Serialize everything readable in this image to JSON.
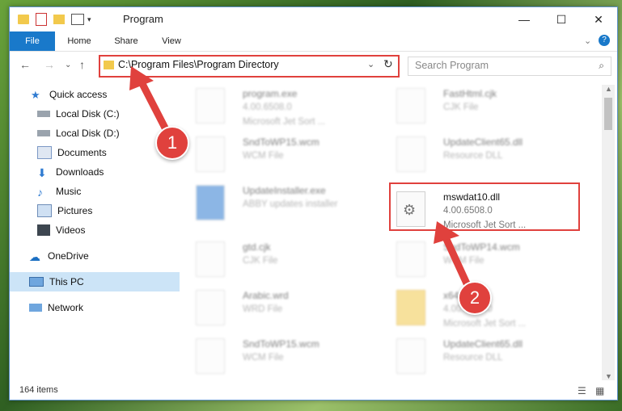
{
  "window": {
    "title": "Program"
  },
  "ribbon": {
    "tabs": [
      "File",
      "Home",
      "Share",
      "View"
    ]
  },
  "nav": {
    "address": "C:\\Program Files\\Program Directory",
    "search_placeholder": "Search Program"
  },
  "sidebar": {
    "items": [
      {
        "label": "Quick access",
        "icon": "star-icon",
        "pinned": false
      },
      {
        "label": "Local Disk (C:)",
        "icon": "drive-icon",
        "pinned": true
      },
      {
        "label": "Local Disk (D:)",
        "icon": "drive-icon",
        "pinned": true
      },
      {
        "label": "Documents",
        "icon": "documents-icon",
        "pinned": true
      },
      {
        "label": "Downloads",
        "icon": "download-icon",
        "pinned": true
      },
      {
        "label": "Music",
        "icon": "music-icon",
        "pinned": true
      },
      {
        "label": "Pictures",
        "icon": "pictures-icon",
        "pinned": true
      },
      {
        "label": "Videos",
        "icon": "videos-icon",
        "pinned": true
      },
      {
        "label": "OneDrive",
        "icon": "cloud-icon",
        "pinned": false
      },
      {
        "label": "This PC",
        "icon": "pc-icon",
        "pinned": false,
        "selected": true
      },
      {
        "label": "Network",
        "icon": "network-icon",
        "pinned": false
      }
    ]
  },
  "files": [
    {
      "name": "program.exe",
      "line2": "4.00.6508.0",
      "line3": "Microsoft Jet Sort ...",
      "col": 0,
      "row": 0
    },
    {
      "name": "FastHtml.cjk",
      "line2": "CJK File",
      "line3": "",
      "col": 1,
      "row": 0
    },
    {
      "name": "SndToWP15.wcm",
      "line2": "WCM File",
      "line3": "",
      "col": 0,
      "row": 1
    },
    {
      "name": "UpdateClient65.dll",
      "line2": "Resource DLL",
      "line3": "",
      "col": 1,
      "row": 1
    },
    {
      "name": "UpdateInstaller.exe",
      "line2": "ABBY updates installer",
      "line3": "",
      "col": 0,
      "row": 2
    },
    {
      "name": "mswdat10.dll",
      "line2": "4.00.6508.0",
      "line3": "Microsoft Jet Sort ...",
      "col": 1,
      "row": 2,
      "highlight": true
    },
    {
      "name": "gtd.cjk",
      "line2": "CJK File",
      "line3": "",
      "col": 0,
      "row": 3
    },
    {
      "name": "SndToWP14.wcm",
      "line2": "WCM File",
      "line3": "",
      "col": 1,
      "row": 3
    },
    {
      "name": "Arabic.wrd",
      "line2": "WRD File",
      "line3": "",
      "col": 0,
      "row": 4
    },
    {
      "name": "x64",
      "line2": "4.00.6508.0",
      "line3": "Microsoft Jet Sort ...",
      "col": 1,
      "row": 4
    },
    {
      "name": "SndToWP15.wcm",
      "line2": "WCM File",
      "line3": "",
      "col": 0,
      "row": 5
    },
    {
      "name": "UpdateClient65.dll",
      "line2": "Resource DLL",
      "line3": "",
      "col": 1,
      "row": 5
    }
  ],
  "status": {
    "count": "164 items"
  },
  "callouts": [
    "1",
    "2"
  ],
  "colors": {
    "accent": "#1979ca",
    "highlight": "#e0413d"
  }
}
